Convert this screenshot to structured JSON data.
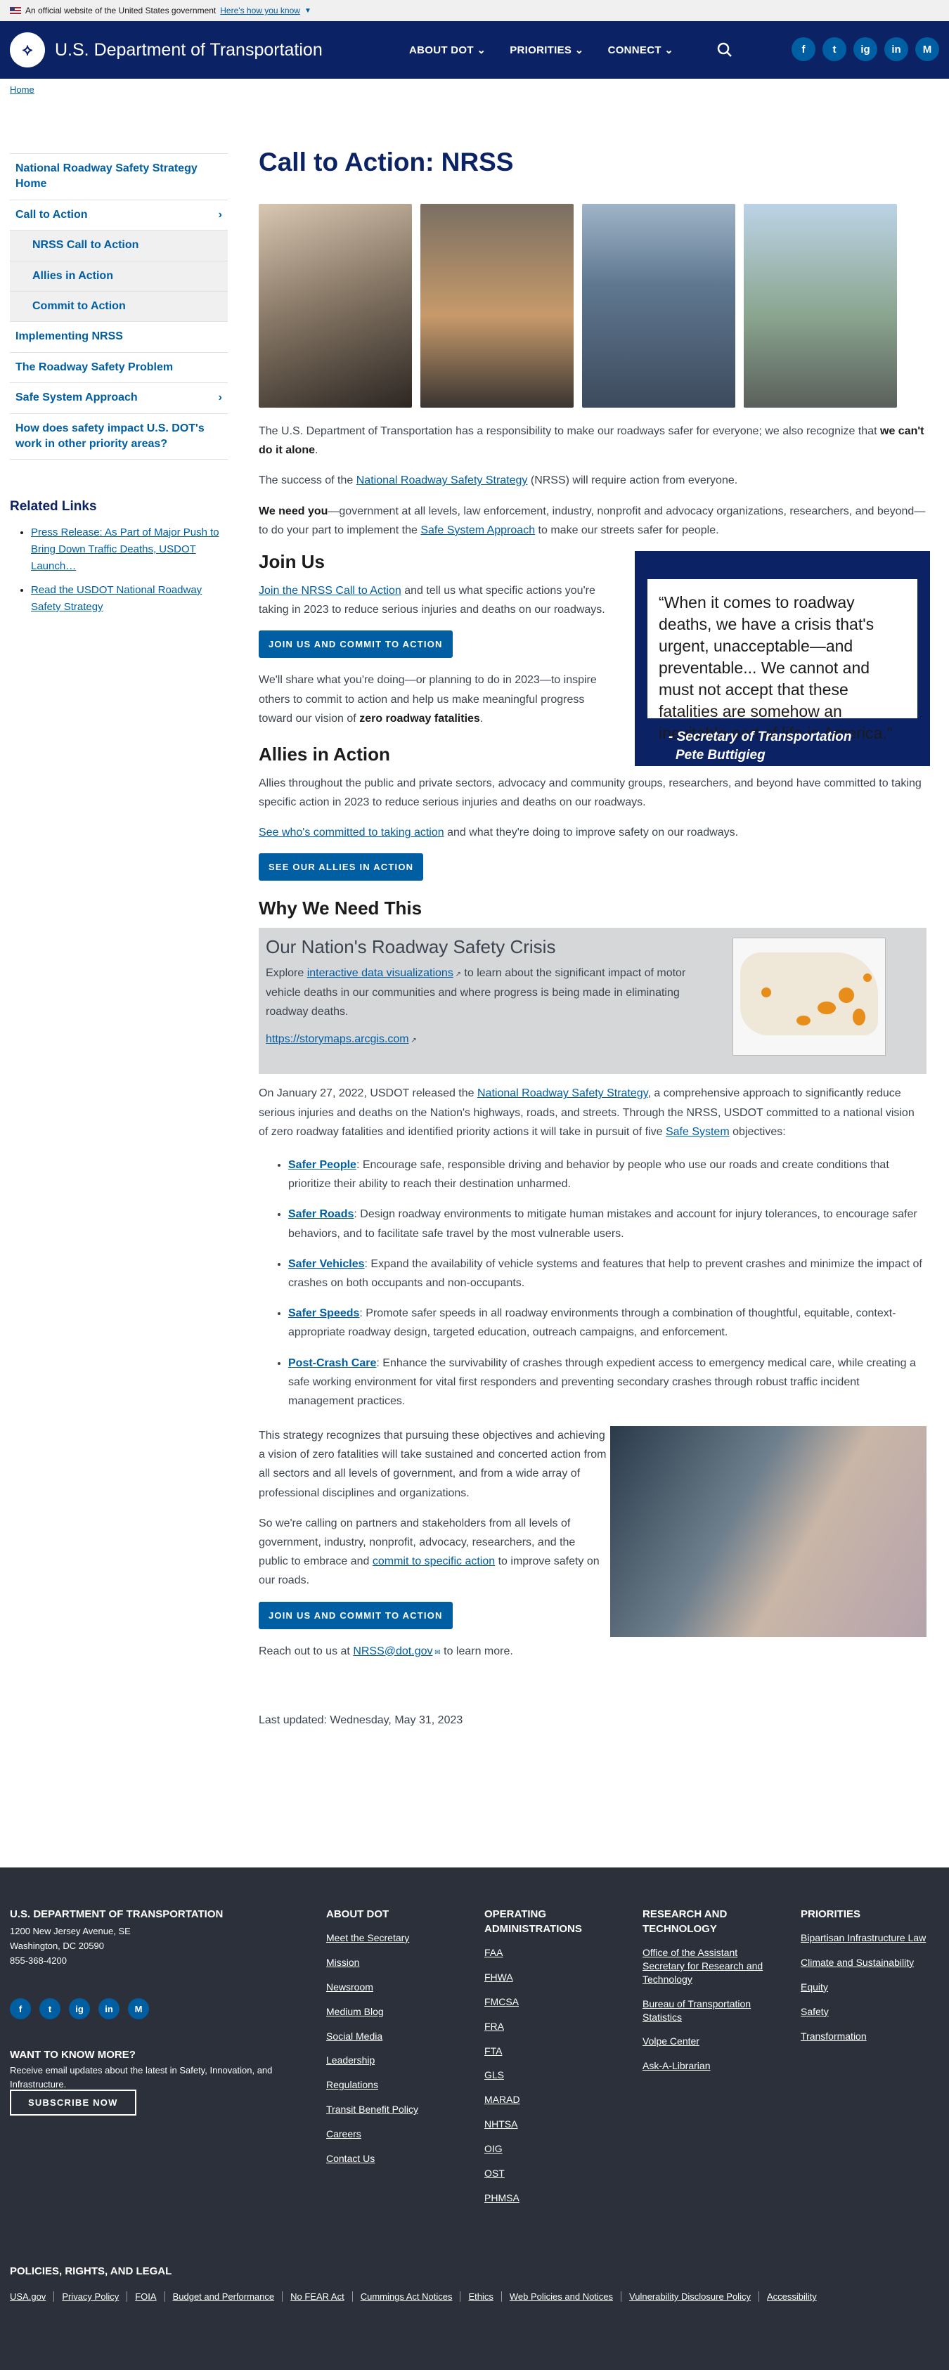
{
  "gov_banner": {
    "text": "An official website of the United States government",
    "link": "Here's how you know"
  },
  "header": {
    "site_name": "U.S. Department of Transportation",
    "nav": [
      "ABOUT DOT",
      "PRIORITIES",
      "CONNECT"
    ],
    "social": [
      "f",
      "t",
      "ig",
      "in",
      "M"
    ]
  },
  "breadcrumb": "Home",
  "sidenav": [
    {
      "label": "National Roadway Safety Strategy Home",
      "sub": false,
      "chev": false
    },
    {
      "label": "Call to Action",
      "sub": false,
      "chev": true
    },
    {
      "label": "NRSS Call to Action",
      "sub": true,
      "chev": false
    },
    {
      "label": "Allies in Action",
      "sub": true,
      "chev": false
    },
    {
      "label": "Commit to Action",
      "sub": true,
      "chev": false
    },
    {
      "label": "Implementing NRSS",
      "sub": false,
      "chev": false
    },
    {
      "label": "The Roadway Safety Problem",
      "sub": false,
      "chev": false
    },
    {
      "label": "Safe System Approach",
      "sub": false,
      "chev": true
    },
    {
      "label": "How does safety impact U.S. DOT's work in other priority areas?",
      "sub": false,
      "chev": false
    }
  ],
  "related": {
    "title": "Related Links",
    "links": [
      "Press Release: As Part of Major Push to Bring Down Traffic Deaths, USDOT Launch…",
      "Read the USDOT National Roadway Safety Strategy"
    ]
  },
  "main": {
    "title": "Call to Action: NRSS",
    "intro1_a": "The U.S. Department of Transportation has a responsibility to make our roadways safer for everyone; we also recognize that ",
    "intro1_b": "we can't do it alone",
    "intro1_c": ".",
    "intro2_a": "The success of the ",
    "intro2_link": "National Roadway Safety Strategy",
    "intro2_b": " (NRSS) will require action from everyone.",
    "intro3_bold": "We need you",
    "intro3_a": "—government at all levels, law enforcement, industry, nonprofit and advocacy organizations, researchers, and beyond—to do your part to implement the ",
    "intro3_link": "Safe System Approach",
    "intro3_b": " to make our streets safer for people.",
    "join": {
      "heading": "Join Us",
      "p1_link": "Join the NRSS Call to Action",
      "p1_rest": " and tell us what specific actions you're taking in 2023 to reduce serious injuries and deaths on our roadways.",
      "button": "JOIN US AND COMMIT TO ACTION",
      "p2_a": "We'll share what you're doing—or planning to do in 2023—to inspire others to commit to action and help us make meaningful progress toward our vision of ",
      "p2_bold": "zero roadway fatalities",
      "p2_b": "."
    },
    "quote": {
      "text": "“When it comes to roadway deaths, we have a crisis that's urgent, unacceptable—and preventable... We cannot and must not accept that these fatalities are somehow an inevitable part of life in America.”",
      "by1": "- Secretary of Transportation",
      "by2": "Pete Buttigieg"
    },
    "allies": {
      "heading": "Allies in Action",
      "p1": "Allies throughout the public and private sectors, advocacy and community groups, researchers, and beyond have committed to taking specific action in 2023 to reduce serious injuries and deaths on our roadways.",
      "p2_link": "See who's committed to taking action",
      "p2_rest": " and what they're doing to improve safety on our roadways.",
      "button": "SEE OUR ALLIES IN ACTION"
    },
    "why": {
      "heading": "Why We Need This",
      "card_title": "Our Nation's Roadway Safety Crisis",
      "card_p_a": "Explore ",
      "card_p_link": "interactive data visualizations",
      "card_p_b": " to learn about the significant impact of motor vehicle deaths in our communities and where progress is being made in eliminating roadway deaths.",
      "card_url": "https://storymaps.arcgis.com",
      "p1_a": "On January 27, 2022, USDOT released the ",
      "p1_link": "National Roadway Safety Strategy",
      "p1_b": ", a comprehensive approach to significantly reduce serious injuries and deaths on the Nation's highways, roads, and streets. Through the NRSS, USDOT committed to a national vision of zero roadway fatalities and identified priority actions it will take in pursuit of five ",
      "p1_link2": "Safe System",
      "p1_c": " objectives:"
    },
    "objectives": [
      {
        "name": "Safer People",
        "text": ": Encourage safe, responsible driving and behavior by people who use our roads and create conditions that prioritize their ability to reach their destination unharmed."
      },
      {
        "name": "Safer Roads",
        "text": ": Design roadway environments to mitigate human mistakes and account for injury tolerances, to encourage safer behaviors, and to facilitate safe travel by the most vulnerable users."
      },
      {
        "name": "Safer Vehicles",
        "text": ": Expand the availability of vehicle systems and features that help to prevent crashes and minimize the impact of crashes on both occupants and non-occupants."
      },
      {
        "name": "Safer Speeds",
        "text": ": Promote safer speeds in all roadway environments through a combination of thoughtful, equitable, context-appropriate roadway design, targeted education, outreach campaigns, and enforcement."
      },
      {
        "name": "Post-Crash Care",
        "text": ": Enhance the survivability of crashes through expedient access to emergency medical care, while creating a safe working environment for vital first responders and preventing secondary crashes through robust traffic incident management practices."
      }
    ],
    "closing": {
      "p1": "This strategy recognizes that pursuing these objectives and achieving a vision of zero fatalities will take sustained and concerted action from all sectors and all levels of government, and from a wide array of professional disciplines and organizations.",
      "p2_a": "So we're calling on partners and stakeholders from all levels of government, industry, nonprofit, advocacy, researchers, and the public to embrace and ",
      "p2_link": "commit to specific action",
      "p2_b": " to improve safety on our roads.",
      "button": "JOIN US AND COMMIT TO ACTION",
      "reach_a": "Reach out to us at ",
      "reach_link": "NRSS@dot.gov",
      "reach_b": " to learn more."
    },
    "updated": "Last updated: Wednesday, May 31, 2023"
  },
  "footer": {
    "org": "U.S. DEPARTMENT OF TRANSPORTATION",
    "addr1": "1200 New Jersey Avenue, SE",
    "addr2": "Washington, DC 20590",
    "phone": "855-368-4200",
    "want_title": "WANT TO KNOW MORE?",
    "want_text": "Receive email updates about the latest in Safety, Innovation, and Infrastructure.",
    "subscribe": "SUBSCRIBE NOW",
    "cols": [
      {
        "title": "ABOUT DOT",
        "links": [
          "Meet the Secretary",
          "Mission",
          "Newsroom",
          "Medium Blog",
          "Social Media",
          "Leadership",
          "Regulations",
          "Transit Benefit Policy",
          "Careers",
          "Contact Us"
        ]
      },
      {
        "title": "OPERATING ADMINISTRATIONS",
        "links": [
          "FAA",
          "FHWA",
          "FMCSA",
          "FRA",
          "FTA",
          "GLS",
          "MARAD",
          "NHTSA",
          "OIG",
          "OST",
          "PHMSA"
        ]
      },
      {
        "title": "RESEARCH AND TECHNOLOGY",
        "links": [
          "Office of the Assistant Secretary for Research and Technology",
          "Bureau of Transportation Statistics",
          "Volpe Center",
          "Ask-A-Librarian"
        ]
      },
      {
        "title": "PRIORITIES",
        "links": [
          "Bipartisan Infrastructure Law",
          "Climate and Sustainability",
          "Equity",
          "Safety",
          "Transformation"
        ]
      }
    ],
    "policies_title": "POLICIES, RIGHTS, AND LEGAL",
    "policies": [
      "USA.gov",
      "Privacy Policy",
      "FOIA",
      "Budget and Performance",
      "No FEAR Act",
      "Cummings Act Notices",
      "Ethics",
      "Web Policies and Notices",
      "Vulnerability Disclosure Policy",
      "Accessibility"
    ]
  }
}
